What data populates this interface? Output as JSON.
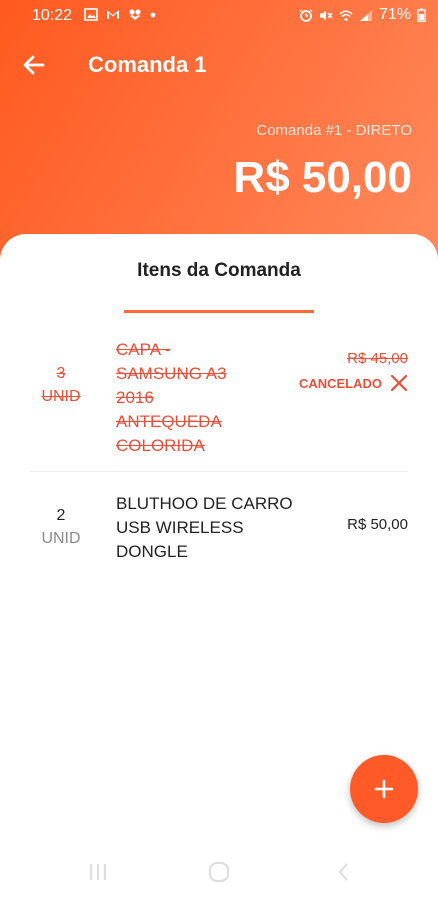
{
  "status_bar": {
    "time": "10:22",
    "battery": "71%",
    "left_icons": [
      "image-icon",
      "gmail-icon",
      "flower-icon",
      "dot-icon"
    ],
    "right_icons": [
      "alarm-icon",
      "mute-icon",
      "wifi-icon",
      "signal-icon",
      "battery-icon"
    ]
  },
  "app_bar": {
    "back_icon": "arrow-left-icon",
    "title": "Comanda 1"
  },
  "header": {
    "subtitle": "Comanda #1 - DIRETO",
    "total": "R$ 50,00"
  },
  "colors": {
    "accent": "#ff5a1f",
    "cancel": "#e8503a"
  },
  "sheet": {
    "title": "Itens da Comanda"
  },
  "items": [
    {
      "qty": "3",
      "unit": "UNID",
      "name_lines": [
        "CAPA -",
        "SAMSUNG A3",
        "2016",
        "ANTEQUEDA",
        "COLORIDA"
      ],
      "price": "R$ 45,00",
      "status": "CANCELADO",
      "status_icon": "close-icon"
    },
    {
      "qty": "2",
      "unit": "UNID",
      "name_lines": [
        "BLUTHOO DE CARRO",
        "USB WIRELESS",
        "DONGLE"
      ],
      "price": "R$ 50,00"
    }
  ],
  "fab": {
    "icon": "plus-icon"
  },
  "nav_bar": {
    "icons": [
      "recent-apps-icon",
      "home-icon",
      "back-icon"
    ]
  }
}
